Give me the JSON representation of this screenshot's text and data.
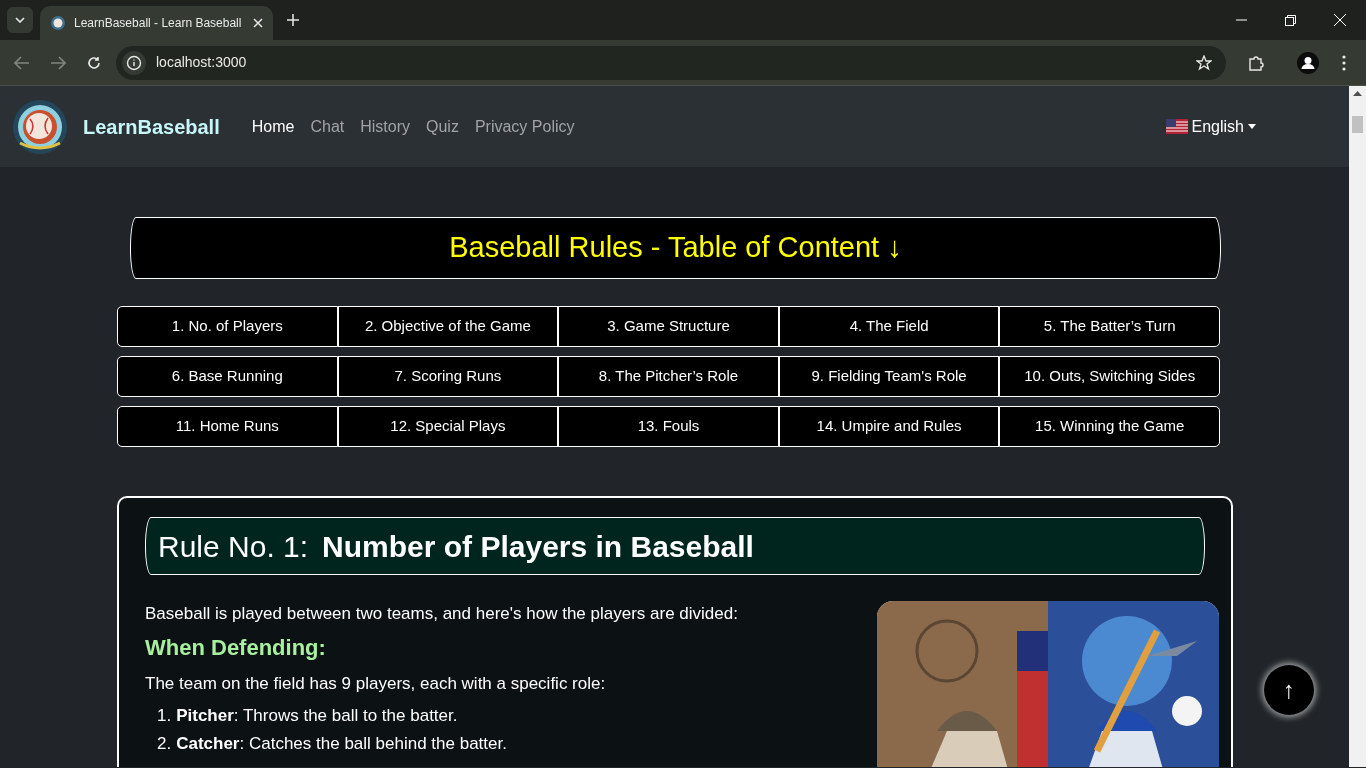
{
  "browser": {
    "tab_title": "LearnBaseball - Learn Baseball",
    "url": "localhost:3000"
  },
  "navbar": {
    "brand": "LearnBaseball",
    "links": [
      {
        "label": "Home",
        "selected": true
      },
      {
        "label": "Chat",
        "selected": false
      },
      {
        "label": "History",
        "selected": false
      },
      {
        "label": "Quiz",
        "selected": false
      },
      {
        "label": "Privacy Policy",
        "selected": false
      }
    ],
    "language": "English"
  },
  "toc": {
    "title": "Baseball Rules - Table of Content ↓",
    "items": [
      "1. No. of Players",
      "2. Objective of the Game",
      "3. Game Structure",
      "4. The Field",
      "5. The Batter’s Turn",
      "6. Base Running",
      "7. Scoring Runs",
      "8. The Pitcher’s Role",
      "9. Fielding Team's Role",
      "10. Outs, Switching Sides",
      "11. Home Runs",
      "12. Special Plays",
      "13. Fouls",
      "14. Umpire and Rules",
      "15. Winning the Game"
    ]
  },
  "rule": {
    "number_label": "Rule No. 1:",
    "title": "Number of Players in Baseball",
    "intro": "Baseball is played between two teams, and here's how the players are divided:",
    "section_heading": "When Defending:",
    "section_text": "The team on the field has 9 players, each with a specific role:",
    "roles": [
      {
        "marker": "1.",
        "text": "**Pitcher**: Throws the ball to the batter."
      },
      {
        "marker": "2.",
        "text": "**Catcher**: Catches the ball behind the batter."
      }
    ]
  },
  "back_to_top": "↑"
}
